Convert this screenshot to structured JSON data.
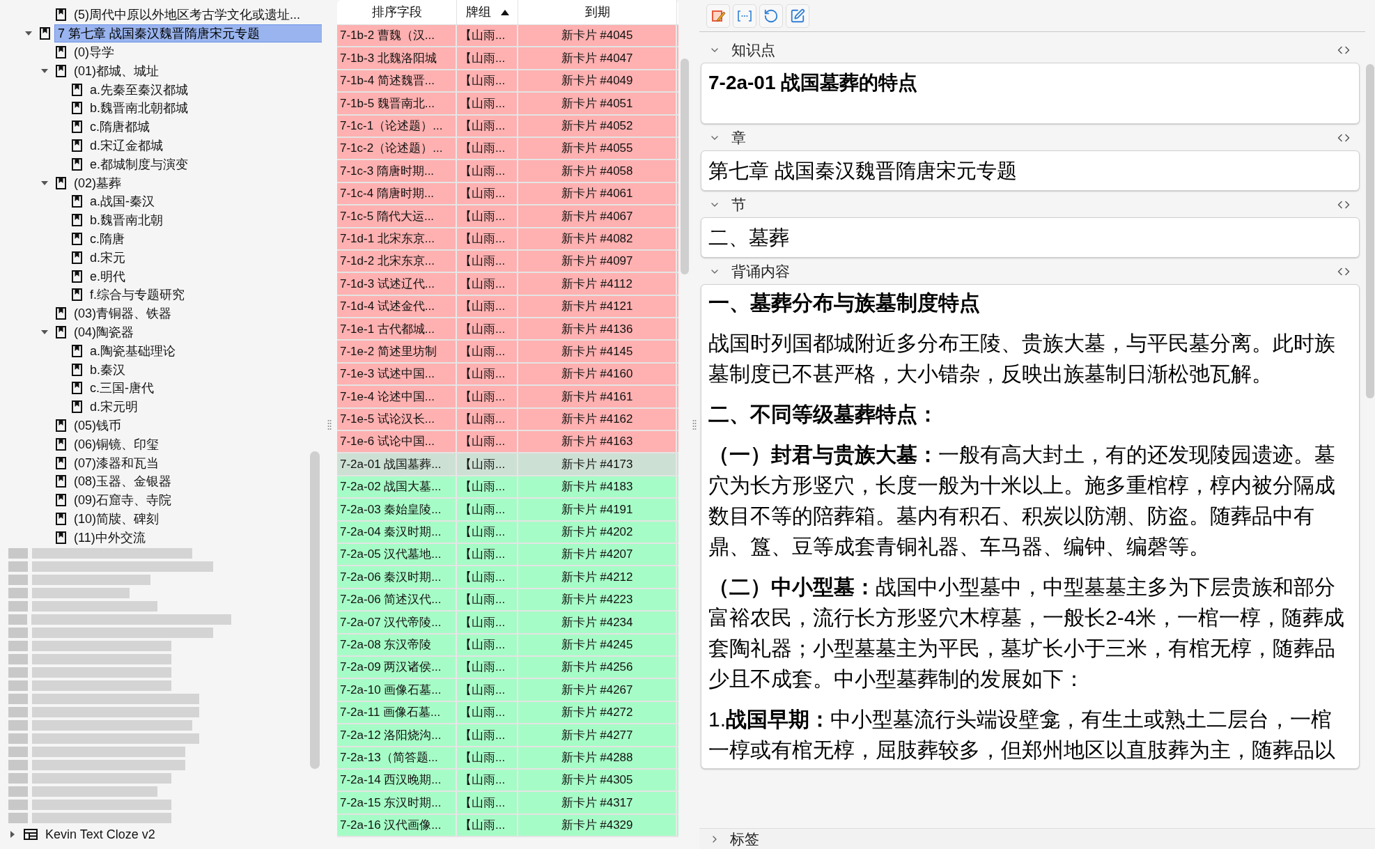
{
  "tree": {
    "items": [
      {
        "kind": "deck_tail",
        "label": "(5)周代中原以外地区考古学文化或遗址...",
        "selected": false
      },
      {
        "kind": "deck",
        "label": "7 第七章 战国秦汉魏晋隋唐宋元专题",
        "selected": true,
        "expanded": true,
        "children": [
          {
            "label": "(0)导学",
            "selected": false
          },
          {
            "label": "(01)都城、城址",
            "selected": false,
            "expanded": true,
            "children": [
              {
                "label": "a.先秦至秦汉都城",
                "selected": false
              },
              {
                "label": "b.魏晋南北朝都城",
                "selected": false
              },
              {
                "label": "c.隋唐都城",
                "selected": false
              },
              {
                "label": "d.宋辽金都城",
                "selected": false
              },
              {
                "label": "e.都城制度与演变",
                "selected": false
              }
            ]
          },
          {
            "label": "(02)墓葬",
            "selected": false,
            "expanded": true,
            "children": [
              {
                "label": "a.战国-秦汉",
                "selected": false
              },
              {
                "label": "b.魏晋南北朝",
                "selected": false
              },
              {
                "label": "c.隋唐",
                "selected": false
              },
              {
                "label": "d.宋元",
                "selected": false
              },
              {
                "label": "e.明代",
                "selected": false
              },
              {
                "label": "f.综合与专题研究",
                "selected": false
              }
            ]
          },
          {
            "label": "(03)青铜器、铁器",
            "selected": false
          },
          {
            "label": "(04)陶瓷器",
            "selected": false,
            "expanded": true,
            "children": [
              {
                "label": "a.陶瓷基础理论",
                "selected": false
              },
              {
                "label": "b.秦汉",
                "selected": false
              },
              {
                "label": "c.三国-唐代",
                "selected": false
              },
              {
                "label": "d.宋元明",
                "selected": false
              }
            ]
          },
          {
            "label": "(05)钱币",
            "selected": false
          },
          {
            "label": "(06)铜镜、印玺",
            "selected": false
          },
          {
            "label": "(07)漆器和瓦当",
            "selected": false
          },
          {
            "label": "(08)玉器、金银器",
            "selected": false
          },
          {
            "label": "(09)石窟寺、寺院",
            "selected": false
          },
          {
            "label": "(10)简牍、碑刻",
            "selected": false
          },
          {
            "label": "(11)中外交流",
            "selected": false
          }
        ]
      },
      {
        "kind": "blurred"
      },
      {
        "kind": "note_type",
        "label": "Kevin Text Cloze v2",
        "selected": false,
        "expanded": false
      }
    ]
  },
  "table": {
    "columns": [
      {
        "label": "排序字段"
      },
      {
        "label": "牌组",
        "sort_ascending": true
      },
      {
        "label": "到期"
      }
    ],
    "rows": [
      {
        "cells": [
          "7-1b-2 曹魏（汉...",
          "【山雨...",
          "新卡片 #4045"
        ],
        "color": "#ffb0b0",
        "selected": false
      },
      {
        "cells": [
          "7-1b-3 北魏洛阳城",
          "【山雨...",
          "新卡片 #4047"
        ],
        "color": "#ffb0b0",
        "selected": false
      },
      {
        "cells": [
          "7-1b-4 简述魏晋...",
          "【山雨...",
          "新卡片 #4049"
        ],
        "color": "#ffb0b0",
        "selected": false
      },
      {
        "cells": [
          "7-1b-5 魏晋南北...",
          "【山雨...",
          "新卡片 #4051"
        ],
        "color": "#ffb0b0",
        "selected": false
      },
      {
        "cells": [
          "7-1c-1（论述题）...",
          "【山雨...",
          "新卡片 #4052"
        ],
        "color": "#ffb0b0",
        "selected": false
      },
      {
        "cells": [
          "7-1c-2（论述题）...",
          "【山雨...",
          "新卡片 #4055"
        ],
        "color": "#ffb0b0",
        "selected": false
      },
      {
        "cells": [
          "7-1c-3 隋唐时期...",
          "【山雨...",
          "新卡片 #4058"
        ],
        "color": "#ffb0b0",
        "selected": false
      },
      {
        "cells": [
          "7-1c-4 隋唐时期...",
          "【山雨...",
          "新卡片 #4061"
        ],
        "color": "#ffb0b0",
        "selected": false
      },
      {
        "cells": [
          "7-1c-5 隋代大运...",
          "【山雨...",
          "新卡片 #4067"
        ],
        "color": "#ffb0b0",
        "selected": false
      },
      {
        "cells": [
          "7-1d-1 北宋东京...",
          "【山雨...",
          "新卡片 #4082"
        ],
        "color": "#ffb0b0",
        "selected": false
      },
      {
        "cells": [
          "7-1d-2 北宋东京...",
          "【山雨...",
          "新卡片 #4097"
        ],
        "color": "#ffb0b0",
        "selected": false
      },
      {
        "cells": [
          "7-1d-3 试述辽代...",
          "【山雨...",
          "新卡片 #4112"
        ],
        "color": "#ffb0b0",
        "selected": false
      },
      {
        "cells": [
          "7-1d-4 试述金代...",
          "【山雨...",
          "新卡片 #4121"
        ],
        "color": "#ffb0b0",
        "selected": false
      },
      {
        "cells": [
          "7-1e-1 古代都城...",
          "【山雨...",
          "新卡片 #4136"
        ],
        "color": "#ffb0b0",
        "selected": false
      },
      {
        "cells": [
          "7-1e-2 简述里坊制",
          "【山雨...",
          "新卡片 #4145"
        ],
        "color": "#ffb0b0",
        "selected": false
      },
      {
        "cells": [
          "7-1e-3 试述中国...",
          "【山雨...",
          "新卡片 #4160"
        ],
        "color": "#ffb0b0",
        "selected": false
      },
      {
        "cells": [
          "7-1e-4 论述中国...",
          "【山雨...",
          "新卡片 #4161"
        ],
        "color": "#ffb0b0",
        "selected": false
      },
      {
        "cells": [
          "7-1e-5 试论汉长...",
          "【山雨...",
          "新卡片 #4162"
        ],
        "color": "#ffb0b0",
        "selected": false
      },
      {
        "cells": [
          "7-1e-6 试论中国...",
          "【山雨...",
          "新卡片 #4163"
        ],
        "color": "#ffb0b0",
        "selected": false
      },
      {
        "cells": [
          "7-2a-01 战国墓葬...",
          "【山雨...",
          "新卡片 #4173"
        ],
        "selected": true
      },
      {
        "cells": [
          "7-2a-02 战国大墓...",
          "【山雨...",
          "新卡片 #4183"
        ],
        "color": "#a6fcc6",
        "selected": false
      },
      {
        "cells": [
          "7-2a-03 秦始皇陵...",
          "【山雨...",
          "新卡片 #4191"
        ],
        "color": "#a6fcc6",
        "selected": false
      },
      {
        "cells": [
          "7-2a-04 秦汉时期...",
          "【山雨...",
          "新卡片 #4202"
        ],
        "color": "#a6fcc6",
        "selected": false
      },
      {
        "cells": [
          "7-2a-05 汉代墓地...",
          "【山雨...",
          "新卡片 #4207"
        ],
        "color": "#a6fcc6",
        "selected": false
      },
      {
        "cells": [
          "7-2a-06 秦汉时期...",
          "【山雨...",
          "新卡片 #4212"
        ],
        "color": "#a6fcc6",
        "selected": false
      },
      {
        "cells": [
          "7-2a-06 简述汉代...",
          "【山雨...",
          "新卡片 #4223"
        ],
        "color": "#a6fcc6",
        "selected": false
      },
      {
        "cells": [
          "7-2a-07 汉代帝陵...",
          "【山雨...",
          "新卡片 #4234"
        ],
        "color": "#a6fcc6",
        "selected": false
      },
      {
        "cells": [
          "7-2a-08 东汉帝陵",
          "【山雨...",
          "新卡片 #4245"
        ],
        "color": "#a6fcc6",
        "selected": false
      },
      {
        "cells": [
          "7-2a-09 两汉诸侯...",
          "【山雨...",
          "新卡片 #4256"
        ],
        "color": "#a6fcc6",
        "selected": false
      },
      {
        "cells": [
          "7-2a-10 画像石墓...",
          "【山雨...",
          "新卡片 #4267"
        ],
        "color": "#a6fcc6",
        "selected": false
      },
      {
        "cells": [
          "7-2a-11 画像石墓...",
          "【山雨...",
          "新卡片 #4272"
        ],
        "color": "#a6fcc6",
        "selected": false
      },
      {
        "cells": [
          "7-2a-12 洛阳烧沟...",
          "【山雨...",
          "新卡片 #4277"
        ],
        "color": "#a6fcc6",
        "selected": false
      },
      {
        "cells": [
          "7-2a-13（简答题...",
          "【山雨...",
          "新卡片 #4288"
        ],
        "color": "#a6fcc6",
        "selected": false
      },
      {
        "cells": [
          "7-2a-14 西汉晚期...",
          "【山雨...",
          "新卡片 #4305"
        ],
        "color": "#a6fcc6",
        "selected": false
      },
      {
        "cells": [
          "7-2a-15 东汉时期...",
          "【山雨...",
          "新卡片 #4317"
        ],
        "color": "#a6fcc6",
        "selected": false
      },
      {
        "cells": [
          "7-2a-16 汉代画像...",
          "【山雨...",
          "新卡片 #4329"
        ],
        "color": "#a6fcc6",
        "selected": false
      }
    ]
  },
  "editor": {
    "fields": [
      {
        "label": "知识点",
        "expanded": true,
        "kind": "title",
        "paragraphs": [
          {
            "kind": "heading",
            "text": "7-2a-01 战国墓葬的特点"
          }
        ]
      },
      {
        "label": "章",
        "expanded": true,
        "kind": "plain",
        "paragraphs": [
          {
            "kind": "text",
            "text": "第七章 战国秦汉魏晋隋唐宋元专题"
          }
        ]
      },
      {
        "label": "节",
        "expanded": true,
        "kind": "plain",
        "paragraphs": [
          {
            "kind": "text",
            "text": "二、墓葬"
          }
        ]
      },
      {
        "label": "背诵内容",
        "expanded": true,
        "kind": "long",
        "paragraphs": [
          {
            "kind": "heading",
            "text": "一、墓葬分布与族墓制度特点"
          },
          {
            "kind": "text",
            "text": "战国时列国都城附近多分布王陵、贵族大墓，与平民墓分离。此时族墓制度已不甚严格，大小错杂，反映出族墓制日渐松弛瓦解。"
          },
          {
            "kind": "heading",
            "text": "二、不同等级墓葬特点："
          },
          {
            "kind": "text",
            "text": "**（一）封君与贵族大墓：**一般有高大封土，有的还发现陵园遗迹。墓穴为长方形竖穴，长度一般为十米以上。施多重棺椁，椁内被分隔成数目不等的陪葬箱。墓内有积石、积炭以防潮、防盗。随葬品中有鼎、簋、豆等成套青铜礼器、车马器、编钟、编磬等。"
          },
          {
            "kind": "text",
            "text": "**（二）中小型墓：**战国中小型墓中，中型墓墓主多为下层贵族和部分富裕农民，流行长方形竖穴木椁墓，一般长2-4米，一棺一椁，随葬成套陶礼器；小型墓墓主为平民，墓圹长小于三米，有棺无椁，随葬品少且不成套。中小型墓葬制的发展如下："
          },
          {
            "kind": "text",
            "text": "1.**战国早期：**中小型墓流行头端设壁龛，有生土或熟土二层台，一棺一椁或有棺无椁，屈肢葬较多，但郑州地区以直肢葬为主，随葬品以"
          }
        ]
      }
    ],
    "tags": {
      "label": "标签",
      "expanded": false
    }
  }
}
